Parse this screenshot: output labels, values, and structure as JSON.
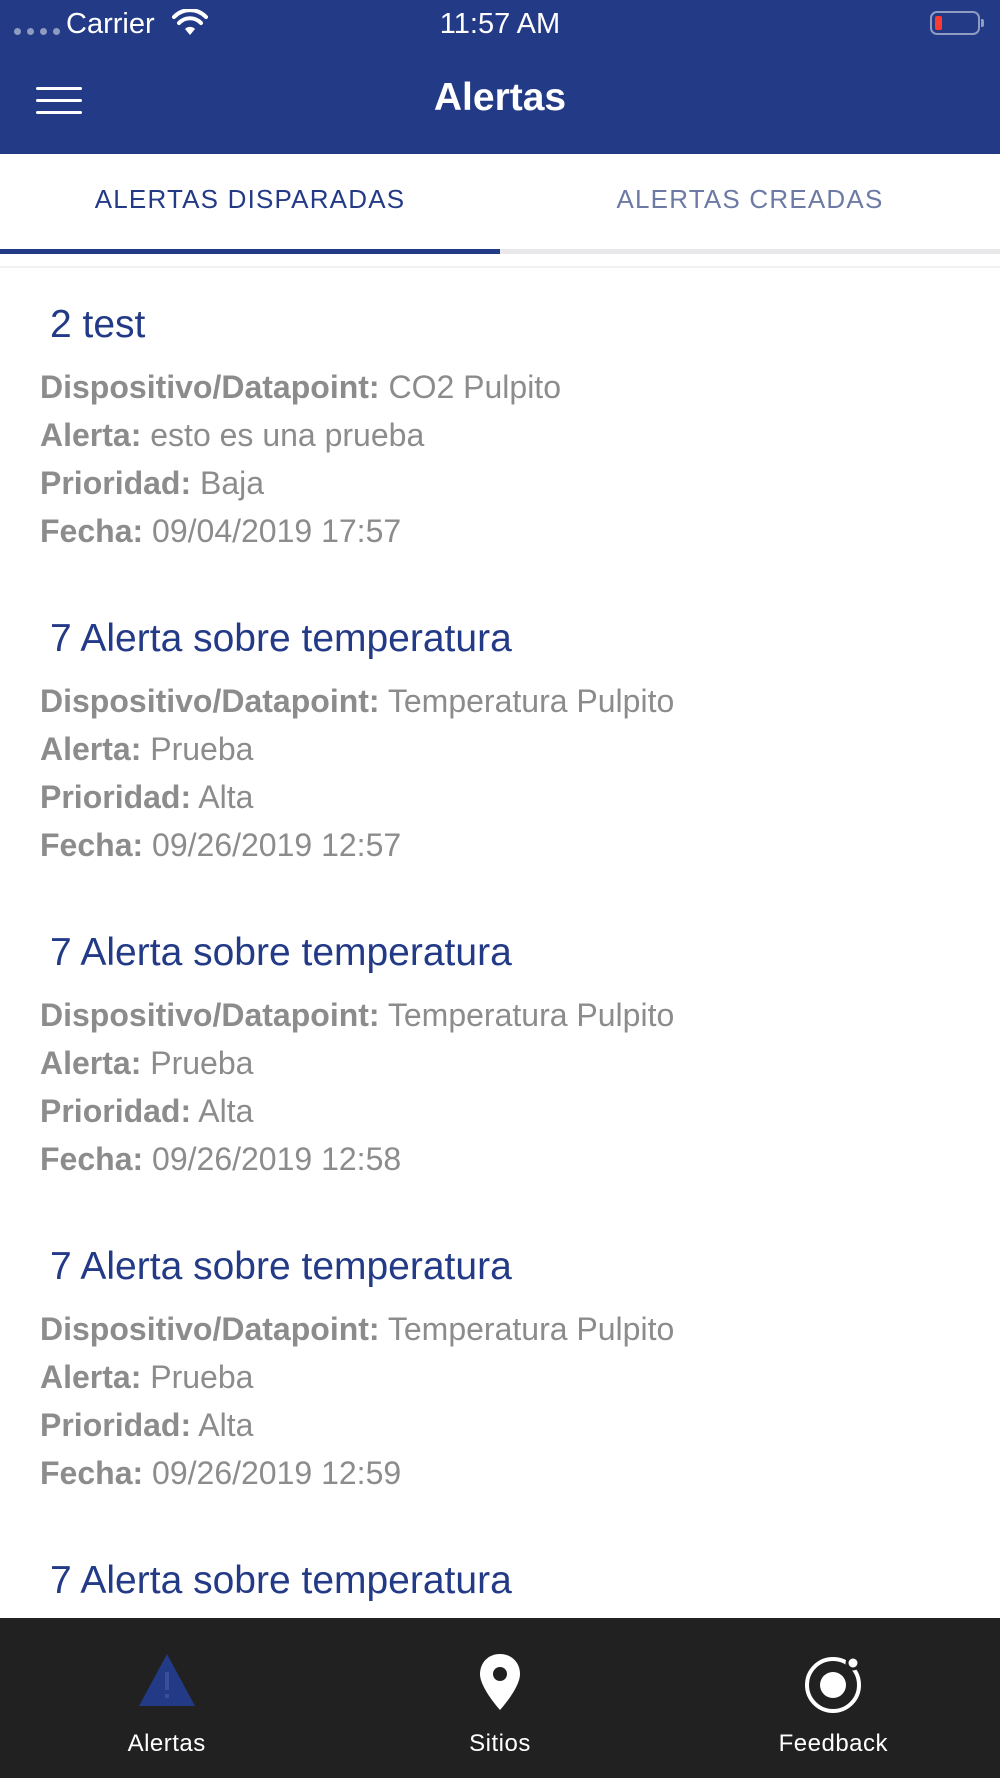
{
  "status_bar": {
    "carrier": "Carrier",
    "time": "11:57 AM"
  },
  "nav": {
    "title": "Alertas",
    "menu_icon": "hamburger-menu-icon"
  },
  "tabs": [
    {
      "label": "ALERTAS DISPARADAS",
      "active": true
    },
    {
      "label": "ALERTAS CREADAS",
      "active": false
    }
  ],
  "field_labels": {
    "device": "Dispositivo/Datapoint:",
    "alert": "Alerta:",
    "priority": "Prioridad:",
    "date": "Fecha:"
  },
  "alerts": [
    {
      "title": "2 test",
      "device": "CO2 Pulpito",
      "alert": "esto es una prueba",
      "priority": "Baja",
      "date": "09/04/2019 17:57"
    },
    {
      "title": "7 Alerta sobre temperatura",
      "device": "Temperatura Pulpito",
      "alert": "Prueba",
      "priority": "Alta",
      "date": "09/26/2019 12:57"
    },
    {
      "title": "7 Alerta sobre temperatura",
      "device": "Temperatura Pulpito",
      "alert": "Prueba",
      "priority": "Alta",
      "date": "09/26/2019 12:58"
    },
    {
      "title": "7 Alerta sobre temperatura",
      "device": "Temperatura Pulpito",
      "alert": "Prueba",
      "priority": "Alta",
      "date": "09/26/2019 12:59"
    },
    {
      "title": "7 Alerta sobre temperatura"
    }
  ],
  "tabbar": [
    {
      "label": "Alertas",
      "icon": "warning-triangle-icon",
      "active": true
    },
    {
      "label": "Sitios",
      "icon": "location-pin-icon",
      "active": false
    },
    {
      "label": "Feedback",
      "icon": "feedback-circle-icon",
      "active": false
    }
  ],
  "colors": {
    "brand": "#233a86",
    "text_secondary": "#8c8c8c",
    "tabbar_bg": "#212121",
    "battery_low": "#ff3b30"
  }
}
